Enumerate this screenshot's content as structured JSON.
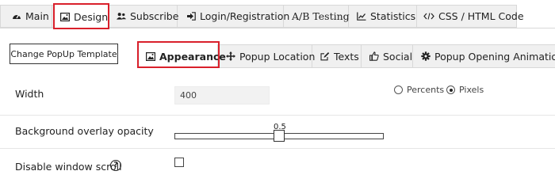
{
  "top_tabs": [
    {
      "label": "Main",
      "icon": "dashboard-icon",
      "active": false
    },
    {
      "label": "Design",
      "icon": "image-icon",
      "active": true
    },
    {
      "label": "Subscribe",
      "icon": "users-icon",
      "active": false
    },
    {
      "label": "Login/Registration",
      "icon": "sign-in-icon",
      "active": false
    },
    {
      "label": "A/B Testing",
      "icon": "ab-icon",
      "active": false
    },
    {
      "label": "Statistics",
      "icon": "line-chart-icon",
      "active": false
    },
    {
      "label": "CSS / HTML Code",
      "icon": "code-icon",
      "active": false
    }
  ],
  "template_button": {
    "label": "Change PopUp Template"
  },
  "sub_tabs": [
    {
      "label": "Appearance",
      "icon": "image-icon",
      "active": true
    },
    {
      "label": "Popup Location",
      "icon": "move-icon",
      "active": false
    },
    {
      "label": "Texts",
      "icon": "edit-icon",
      "active": false
    },
    {
      "label": "Social",
      "icon": "thumbs-up-icon",
      "active": false
    },
    {
      "label": "Popup Opening Animation",
      "icon": "gear-icon",
      "active": false
    }
  ],
  "settings": {
    "width": {
      "label": "Width",
      "value": "400",
      "unit_options": [
        {
          "label": "Percents",
          "checked": false
        },
        {
          "label": "Pixels",
          "checked": true
        }
      ]
    },
    "overlay": {
      "label": "Background overlay opacity",
      "value_text": "0.5",
      "value": 0.5,
      "max": 1
    },
    "disable_scroll": {
      "label": "Disable window scroll",
      "help": "?",
      "checked": false
    }
  },
  "colors": {
    "highlight": "#d9202b",
    "tab_bg": "#f0f0f0",
    "border": "#d8d8d8"
  }
}
